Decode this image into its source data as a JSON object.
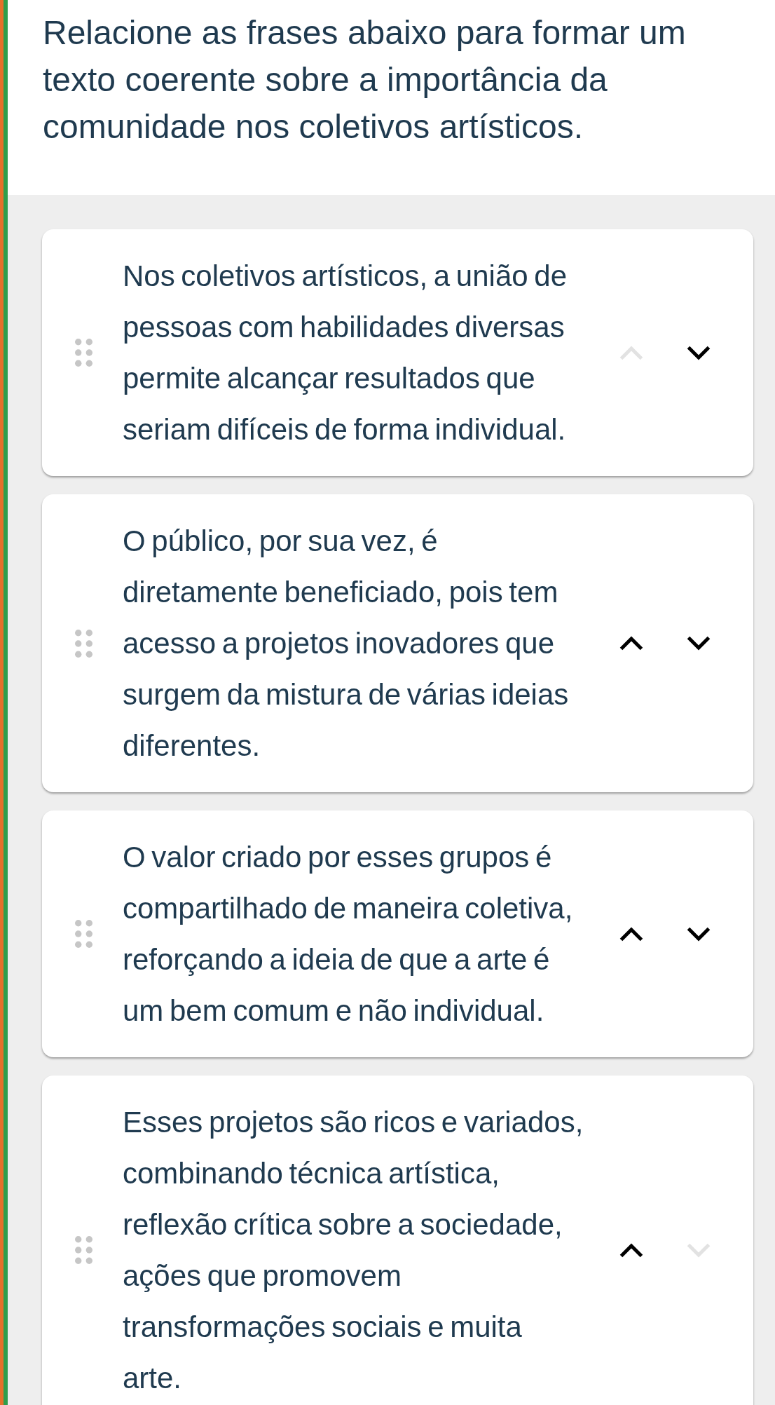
{
  "question": {
    "text": "Relacione as frases abaixo para formar um texto coerente sobre a importância da comunidade nos coletivos artísticos."
  },
  "items": [
    {
      "text": "Nos coletivos artísticos, a união de pessoas com habilidades diversas permite alcançar resultados que seriam difíceis de forma individual.",
      "up_disabled": true,
      "down_disabled": false
    },
    {
      "text": "O público, por sua vez, é diretamente beneficiado, pois tem acesso a projetos inovadores que surgem da mistura de várias ideias diferentes.",
      "up_disabled": false,
      "down_disabled": false
    },
    {
      "text": "O valor criado por esses grupos é compartilhado de maneira coletiva, reforçando a ideia de que a arte é um bem comum e não individual.",
      "up_disabled": false,
      "down_disabled": false
    },
    {
      "text": "Esses projetos são ricos e variados, combinando técnica artística, reflexão crítica sobre a sociedade, ações que promovem transformações sociais e muita arte.",
      "up_disabled": false,
      "down_disabled": true
    }
  ]
}
